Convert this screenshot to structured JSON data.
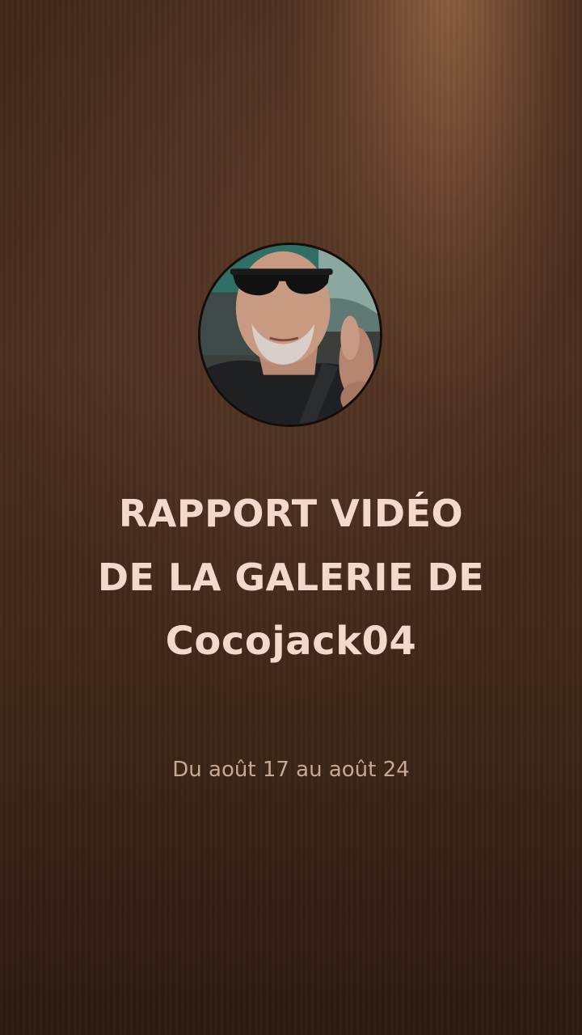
{
  "background": {
    "base_color": "#3d2518",
    "highlight_color": "#c88c5f"
  },
  "avatar": {
    "icon": "profile-photo",
    "description_hidden": true
  },
  "title": {
    "line1": "RAPPORT VIDÉO",
    "line2": "DE LA GALERIE DE",
    "line3": "Cocojack04",
    "color": "#f2d9cc"
  },
  "dates": {
    "text": "Du août 17 au août 24",
    "color": "#c6a893"
  }
}
